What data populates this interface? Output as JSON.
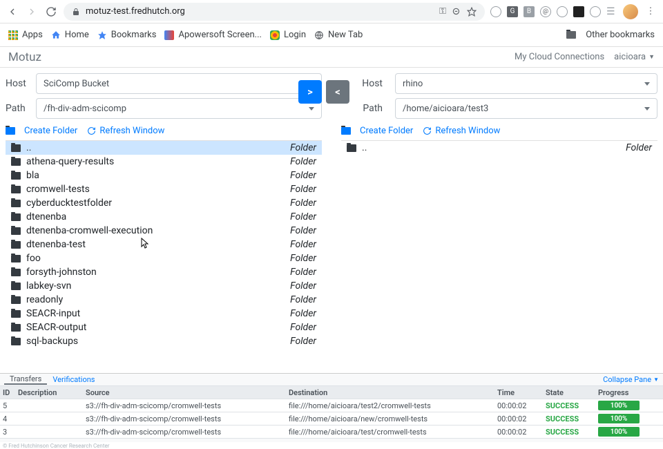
{
  "chrome": {
    "url": "motuz-test.fredhutch.org",
    "bookmarks": [
      "Apps",
      "Home",
      "Bookmarks",
      "Apowersoft Screen...",
      "Login",
      "New Tab"
    ],
    "other_bookmarks": "Other bookmarks"
  },
  "app": {
    "title": "Motuz",
    "cloud_link": "My Cloud Connections",
    "user": "aicioara"
  },
  "left": {
    "host_label": "Host",
    "host_value": "SciComp Bucket",
    "path_label": "Path",
    "path_value": "/fh-div-adm-scicomp",
    "create_folder": "Create Folder",
    "refresh": "Refresh Window",
    "files": [
      {
        "name": "..",
        "type": "Folder",
        "up": true
      },
      {
        "name": "athena-query-results",
        "type": "Folder"
      },
      {
        "name": "bla",
        "type": "Folder"
      },
      {
        "name": "cromwell-tests",
        "type": "Folder"
      },
      {
        "name": "cyberducktestfolder",
        "type": "Folder"
      },
      {
        "name": "dtenenba",
        "type": "Folder"
      },
      {
        "name": "dtenenba-cromwell-execution",
        "type": "Folder"
      },
      {
        "name": "dtenenba-test",
        "type": "Folder"
      },
      {
        "name": "foo",
        "type": "Folder"
      },
      {
        "name": "forsyth-johnston",
        "type": "Folder"
      },
      {
        "name": "labkey-svn",
        "type": "Folder"
      },
      {
        "name": "readonly",
        "type": "Folder"
      },
      {
        "name": "SEACR-input",
        "type": "Folder"
      },
      {
        "name": "SEACR-output",
        "type": "Folder"
      },
      {
        "name": "sql-backups",
        "type": "Folder"
      }
    ]
  },
  "right": {
    "host_label": "Host",
    "host_value": "rhino",
    "path_label": "Path",
    "path_value": "/home/aicioara/test3",
    "create_folder": "Create Folder",
    "refresh": "Refresh Window",
    "files": [
      {
        "name": "..",
        "type": "Folder",
        "up": false
      }
    ]
  },
  "transfer": {
    "right": ">",
    "left": "<"
  },
  "transfers": {
    "tab1": "Transfers",
    "tab2": "Verifications",
    "collapse": "Collapse Pane",
    "headers": {
      "id": "ID",
      "desc": "Description",
      "src": "Source",
      "dst": "Destination",
      "time": "Time",
      "state": "State",
      "prog": "Progress"
    },
    "rows": [
      {
        "id": "5",
        "desc": "",
        "src": "s3://fh-div-adm-scicomp/cromwell-tests",
        "dst": "file:///home/aicioara/test2/cromwell-tests",
        "time": "00:00:02",
        "state": "SUCCESS",
        "prog": "100%"
      },
      {
        "id": "4",
        "desc": "",
        "src": "s3://fh-div-adm-scicomp/cromwell-tests",
        "dst": "file:///home/aicioara/new/cromwell-tests",
        "time": "00:00:02",
        "state": "SUCCESS",
        "prog": "100%"
      },
      {
        "id": "3",
        "desc": "",
        "src": "s3://fh-div-adm-scicomp/cromwell-tests",
        "dst": "file:///home/aicioara/test/cromwell-tests",
        "time": "00:00:02",
        "state": "SUCCESS",
        "prog": "100%"
      }
    ]
  },
  "footer": "© Fred Hutchinson Cancer Research Center"
}
